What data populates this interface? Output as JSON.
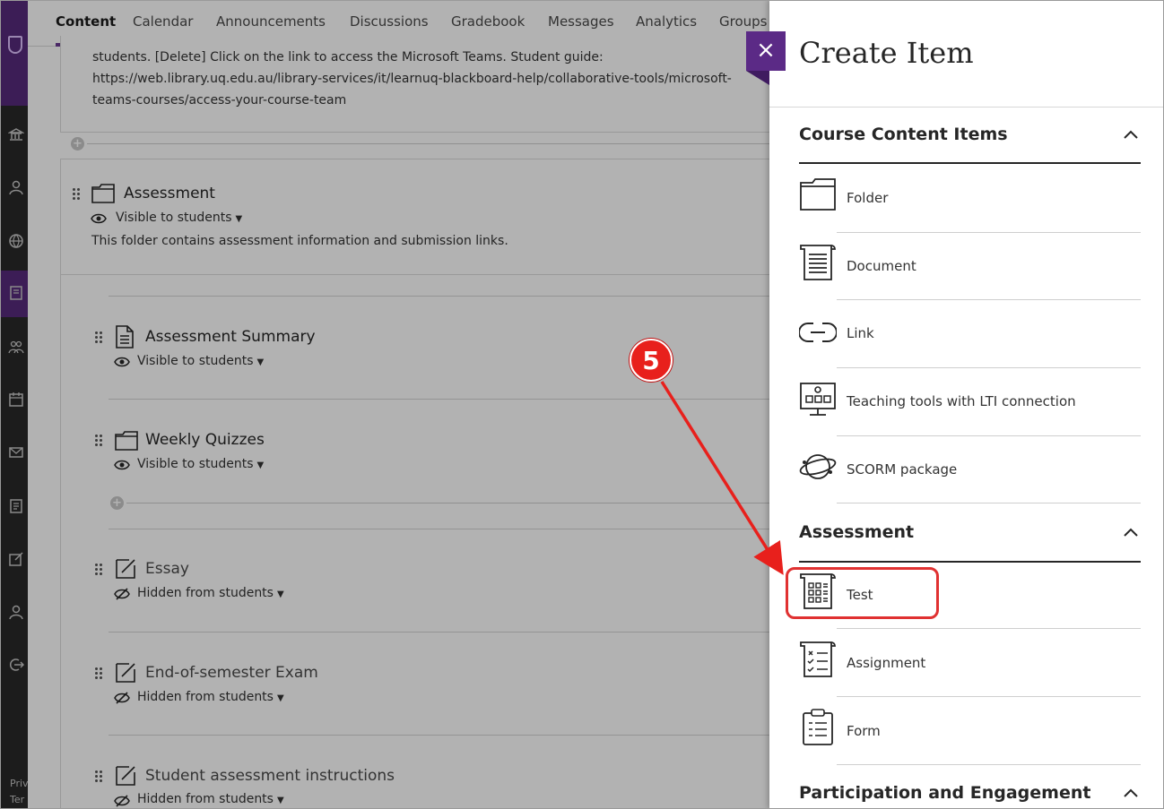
{
  "tabs": [
    {
      "label": "Content"
    },
    {
      "label": "Calendar"
    },
    {
      "label": "Announcements"
    },
    {
      "label": "Discussions"
    },
    {
      "label": "Gradebook"
    },
    {
      "label": "Messages"
    },
    {
      "label": "Analytics"
    },
    {
      "label": "Groups"
    }
  ],
  "rail": {
    "footer_1": "Priv",
    "footer_2": "Ter"
  },
  "content": {
    "top_card_lines": [
      "students. [Delete] Click on the link to access the Microsoft Teams. Student guide:",
      "https://web.library.uq.edu.au/library-services/it/learnuq-blackboard-help/collaborative-tools/microsoft-",
      "teams-courses/access-your-course-team"
    ],
    "folder": {
      "title": "Assessment",
      "visibility": "Visible to students",
      "description": "This folder contains assessment information and submission links."
    },
    "items": [
      {
        "title": "Assessment Summary",
        "visibility": "Visible to students"
      },
      {
        "title": "Weekly Quizzes",
        "visibility": "Visible to students"
      },
      {
        "title": "Essay",
        "visibility": "Hidden from students"
      },
      {
        "title": "End-of-semester Exam",
        "visibility": "Hidden from students"
      },
      {
        "title": "Student assessment instructions",
        "visibility": "Hidden from students"
      }
    ]
  },
  "panel": {
    "title": "Create Item",
    "close_label": "×",
    "sections": [
      {
        "heading": "Course Content Items",
        "options": [
          {
            "label": "Folder",
            "icon": "folder-icon"
          },
          {
            "label": "Document",
            "icon": "document-icon"
          },
          {
            "label": "Link",
            "icon": "link-icon"
          },
          {
            "label": "Teaching tools with LTI connection",
            "icon": "lti-icon"
          },
          {
            "label": "SCORM package",
            "icon": "scorm-icon"
          }
        ]
      },
      {
        "heading": "Assessment",
        "options": [
          {
            "label": "Test",
            "icon": "test-icon"
          },
          {
            "label": "Assignment",
            "icon": "assignment-icon"
          },
          {
            "label": "Form",
            "icon": "form-icon"
          }
        ]
      },
      {
        "heading": "Participation and Engagement",
        "options": []
      }
    ]
  },
  "annotation": {
    "step": "5",
    "color": "#e8201c"
  },
  "colors": {
    "brand": "#5b2a86",
    "rail": "#1c1c1c"
  }
}
